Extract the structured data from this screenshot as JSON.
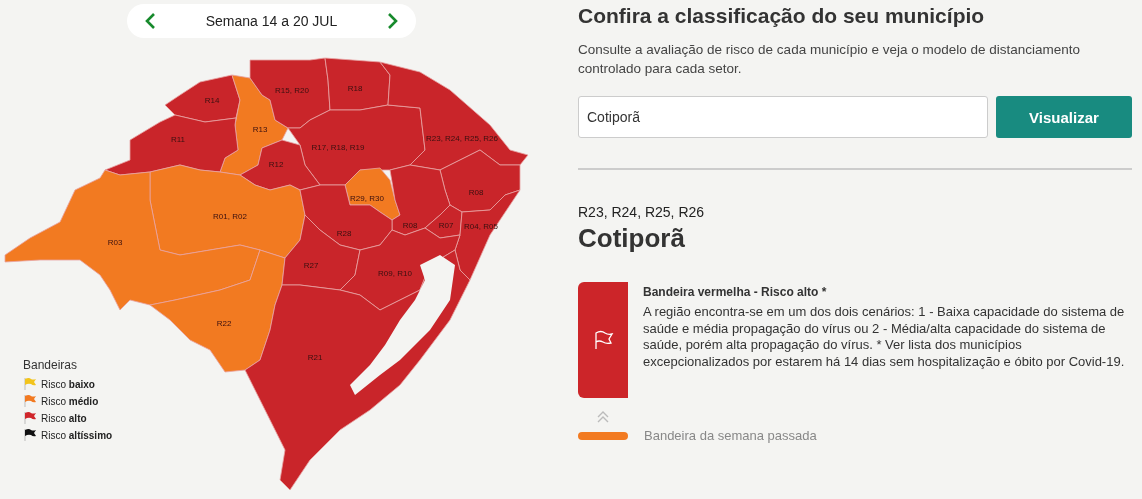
{
  "week_selector": {
    "label": "Semana 14 a 20 JUL"
  },
  "map": {
    "regions": [
      {
        "label": "R14",
        "color": "#c9252a"
      },
      {
        "label": "R13",
        "color": "#f27a21"
      },
      {
        "label": "R11",
        "color": "#c9252a"
      },
      {
        "label": "R15, R20",
        "color": "#c9252a"
      },
      {
        "label": "R18",
        "color": "#c9252a"
      },
      {
        "label": "R17, R18, R19",
        "color": "#c9252a"
      },
      {
        "label": "R12",
        "color": "#c9252a"
      },
      {
        "label": "R23, R24, R25, R26",
        "color": "#c9252a"
      },
      {
        "label": "R08",
        "color": "#c9252a"
      },
      {
        "label": "R29, R30",
        "color": "#f27a21"
      },
      {
        "label": "R08",
        "color": "#c9252a"
      },
      {
        "label": "R07",
        "color": "#c9252a"
      },
      {
        "label": "R04, R05",
        "color": "#c9252a"
      },
      {
        "label": "R01, R02",
        "color": "#f27a21"
      },
      {
        "label": "R03",
        "color": "#f27a21"
      },
      {
        "label": "R22",
        "color": "#f27a21"
      },
      {
        "label": "R28",
        "color": "#c9252a"
      },
      {
        "label": "R27",
        "color": "#c9252a"
      },
      {
        "label": "R09, R10",
        "color": "#c9252a"
      },
      {
        "label": "R21",
        "color": "#c9252a"
      }
    ]
  },
  "legend": {
    "title": "Bandeiras",
    "items": [
      {
        "label": "Risco **baixo**",
        "color": "#f2c41c"
      },
      {
        "label": "Risco **médio**",
        "color": "#f27a21"
      },
      {
        "label": "Risco **alto**",
        "color": "#d0262b"
      },
      {
        "label": "Risco **altíssimo**",
        "color": "#111111"
      }
    ]
  },
  "search": {
    "title": "Confira a classificação do seu município",
    "description": "Consulte a avaliação de risco de cada município e veja o modelo de distanciamento controlado para cada setor.",
    "field": {
      "value": "Cotiporã"
    },
    "button": "Visualizar"
  },
  "result": {
    "region": "R23, R24, R25, R26",
    "municipality": "Cotiporã",
    "flag": {
      "title": "Bandeira vermelha - Risco alto *",
      "description": "A região encontra-se em um dos dois cenários: 1 - Baixa capacidade do sistema de saúde e média propagação do vírus ou 2 - Média/alta capacidade do sistema de saúde, porém alta propagação do vírus. * Ver lista dos municípios excepcionalizados por estarem há 14 dias sem hospitalização e óbito por Covid-19.",
      "color": "#cc2529"
    },
    "previous_week": {
      "label": "Bandeira da semana passada",
      "color": "#f27a21"
    }
  }
}
